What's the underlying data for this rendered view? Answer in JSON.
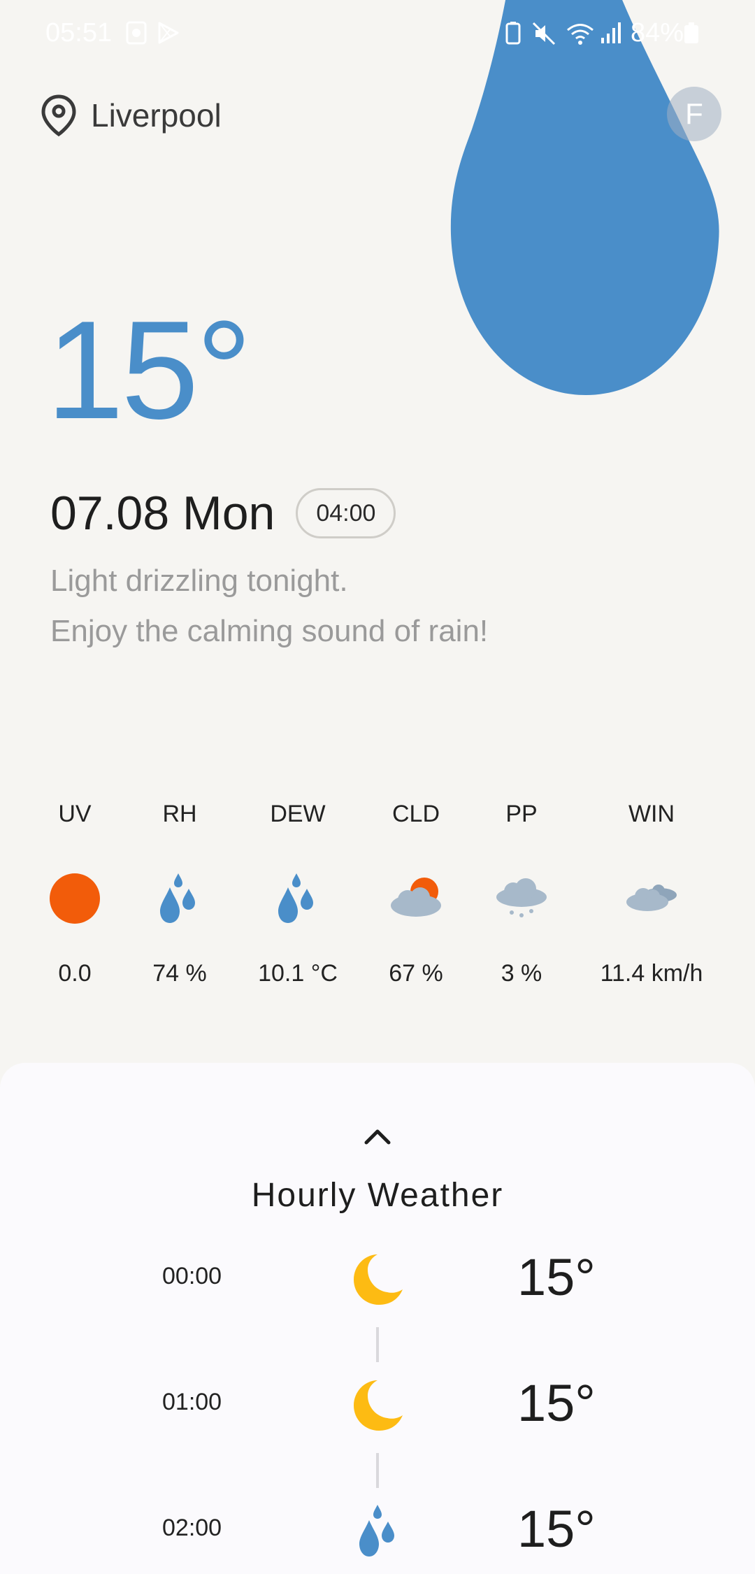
{
  "status_bar": {
    "time": "05:51",
    "battery": "84%",
    "icons": [
      "gallery-icon",
      "play-store-icon",
      "battery-saver-icon",
      "mute-icon",
      "wifi-icon",
      "signal-icon",
      "battery-icon"
    ]
  },
  "location": {
    "name": "Liverpool",
    "icon": "location-pin-icon"
  },
  "profile": {
    "initial": "F"
  },
  "current": {
    "temperature": "15°",
    "date": "07.08 Mon",
    "time": "04:00",
    "description_line1": "Light drizzling tonight.",
    "description_line2": "Enjoy the calming sound of rain!",
    "hero_icon": "rain-drop-icon"
  },
  "metrics": [
    {
      "label": "UV",
      "value": "0.0",
      "icon": "sun-icon"
    },
    {
      "label": "RH",
      "value": "74 %",
      "icon": "rain-drops-icon"
    },
    {
      "label": "DEW",
      "value": "10.1 °C",
      "icon": "rain-drops-icon"
    },
    {
      "label": "CLD",
      "value": "67 %",
      "icon": "partly-cloudy-icon"
    },
    {
      "label": "PP",
      "value": "3 %",
      "icon": "snow-cloud-icon"
    },
    {
      "label": "WIN",
      "value": "11.4 km/h",
      "icon": "clouds-icon"
    }
  ],
  "hourly": {
    "title": "Hourly Weather",
    "items": [
      {
        "time": "00:00",
        "temp": "15°",
        "icon": "moon-icon"
      },
      {
        "time": "01:00",
        "temp": "15°",
        "icon": "moon-icon"
      },
      {
        "time": "02:00",
        "temp": "15°",
        "icon": "rain-drops-icon"
      }
    ]
  },
  "colors": {
    "background": "#f6f5f2",
    "accent_blue": "#4a8ec9",
    "sun_orange": "#f25c0a",
    "moon_yellow": "#fdbb13",
    "cloud_grey": "#a7b9ca",
    "sheet": "#fbfafd"
  }
}
